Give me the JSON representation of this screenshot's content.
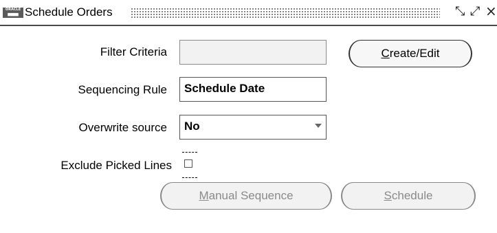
{
  "window": {
    "title": "Schedule Orders",
    "icon": "oracle-app-icon",
    "controls": [
      "minimize-icon",
      "maximize-icon",
      "close-icon"
    ]
  },
  "form": {
    "filter_criteria": {
      "label": "Filter Criteria",
      "value": ""
    },
    "create_edit_button": {
      "label_mnemonic": "C",
      "label_rest": "reate/Edit"
    },
    "sequencing_rule": {
      "label": "Sequencing Rule",
      "value": "Schedule Date"
    },
    "overwrite_source": {
      "label": "Overwrite source",
      "value": "No"
    },
    "exclude_picked_lines": {
      "label": "Exclude Picked Lines",
      "checked": false
    },
    "manual_sequence_button": {
      "label_mnemonic": "M",
      "label_rest": "anual Sequence",
      "enabled": false
    },
    "schedule_button": {
      "label_mnemonic": "S",
      "label_rest": "chedule",
      "enabled": false
    }
  }
}
